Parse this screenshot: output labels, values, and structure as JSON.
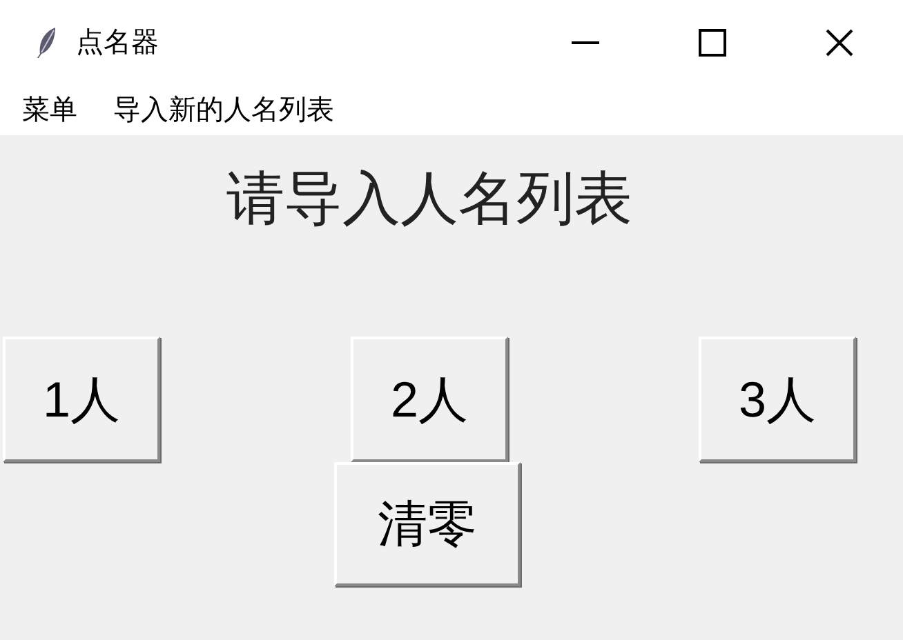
{
  "window": {
    "title": "点名器"
  },
  "menu": [
    "菜单",
    "导入新的人名列表"
  ],
  "label": "请导入人名列表",
  "buttons": [
    {
      "label": "1人"
    },
    {
      "label": "2人"
    },
    {
      "label": "3人"
    }
  ],
  "clear_button": {
    "label": "清零"
  }
}
